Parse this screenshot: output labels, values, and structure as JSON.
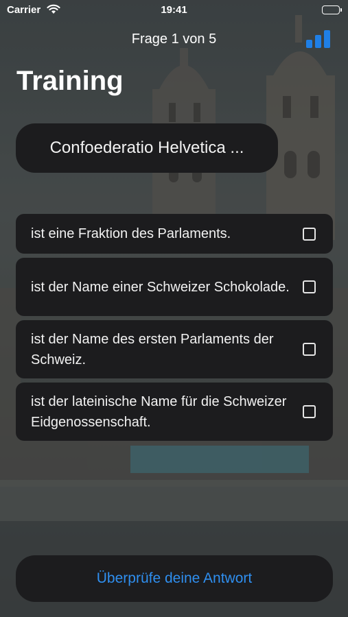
{
  "status_bar": {
    "carrier": "Carrier",
    "time": "19:41"
  },
  "nav": {
    "progress_title": "Frage 1 von 5",
    "stats_icon": "bar-chart-icon",
    "accent_color": "#2f8ff0"
  },
  "page": {
    "title": "Training"
  },
  "question": {
    "text": "Confoederatio Helvetica ..."
  },
  "answers": [
    {
      "text": "ist eine Fraktion des Parlaments.",
      "checked": false
    },
    {
      "text": "ist der Name einer Schweizer Schokolade.",
      "checked": false
    },
    {
      "text": "ist der Name des ersten Parlaments der Schweiz.",
      "checked": false
    },
    {
      "text": "ist der lateinische Name für die Schweizer Eidgenossenschaft.",
      "checked": false
    }
  ],
  "actions": {
    "check_label": "Überprüfe deine Antwort"
  }
}
